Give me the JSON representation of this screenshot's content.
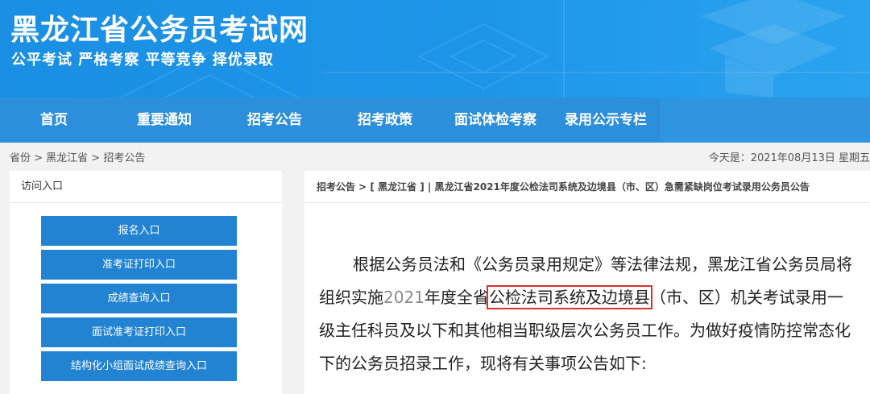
{
  "header": {
    "site_title": "黑龙江省公务员考试网",
    "slogan": "公平考试 严格考察 平等竞争 择优录取"
  },
  "nav": {
    "items": [
      "首页",
      "重要通知",
      "招考公告",
      "招考政策",
      "面试体检考察",
      "录用公示专栏"
    ]
  },
  "breadcrumb": "省份 > 黑龙江省 > 招考公告",
  "date_text": "今天是：2021年08月13日 星期五",
  "sidebar": {
    "title": "访问入口",
    "buttons": [
      "报名入口",
      "准考证打印入口",
      "成绩查询入口",
      "面试准考证打印入口",
      "结构化小组面试成绩查询入口"
    ]
  },
  "article": {
    "crumb": "招考公告 > [ 黑龙江省 ] | 黑龙江省2021年度公检法司系统及边境县（市、区）急需紧缺岗位考试录用公务员公告",
    "text_before": "根据公务员法和《公务员录用规定》等法律法规，黑龙江省公务员局将组织实施",
    "year": "2021",
    "text_mid": "年度全省",
    "highlight": "公检法司系统及边境县",
    "text_after": "（市、区）机关考试录用一级主任科员及以下和其他相当职级层次公务员工作。为做好疫情防控常态化下的公务员招录工作，现将有关事项公告如下:"
  },
  "colors": {
    "header": "#1a8fe3",
    "nav": "#2f95e0",
    "button": "#2283d2",
    "highlight_border": "#d9302b"
  }
}
